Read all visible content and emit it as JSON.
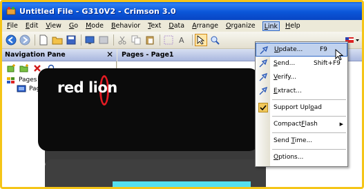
{
  "window": {
    "title": "Untitled File - G310V2 - Crimson 3.0"
  },
  "menubar": [
    {
      "pre": "",
      "u": "F",
      "post": "ile"
    },
    {
      "pre": "",
      "u": "E",
      "post": "dit"
    },
    {
      "pre": "",
      "u": "V",
      "post": "iew"
    },
    {
      "pre": "",
      "u": "G",
      "post": "o"
    },
    {
      "pre": "",
      "u": "M",
      "post": "ode"
    },
    {
      "pre": "",
      "u": "B",
      "post": "ehavior"
    },
    {
      "pre": "",
      "u": "T",
      "post": "ext"
    },
    {
      "pre": "",
      "u": "D",
      "post": "ata"
    },
    {
      "pre": "",
      "u": "A",
      "post": "rrange"
    },
    {
      "pre": "",
      "u": "O",
      "post": "rganize"
    },
    {
      "pre": "",
      "u": "L",
      "post": "ink"
    },
    {
      "pre": "",
      "u": "H",
      "post": "elp"
    }
  ],
  "nav": {
    "title": "Navigation Pane",
    "close": "✕",
    "tree": {
      "root": "Pages",
      "child": "Page1"
    }
  },
  "pages_header": "Pages - Page1",
  "logo": {
    "text": "red lion"
  },
  "link_menu": {
    "update": {
      "pre": "",
      "u": "U",
      "post": "pdate...",
      "shortcut": "F9"
    },
    "send": {
      "pre": "",
      "u": "S",
      "post": "end...",
      "shortcut": "Shift+F9"
    },
    "verify": {
      "pre": "",
      "u": "V",
      "post": "erify..."
    },
    "extract": {
      "pre": "",
      "u": "E",
      "post": "xtract..."
    },
    "support_upload": {
      "pre": "Support Upl",
      "u": "o",
      "post": "ad",
      "checked": true
    },
    "compactflash": {
      "pre": "Compact",
      "u": "F",
      "post": "lash"
    },
    "send_time": {
      "pre": "Send ",
      "u": "T",
      "post": "ime..."
    },
    "options": {
      "pre": "",
      "u": "O",
      "post": "ptions..."
    }
  },
  "colors": {
    "title_blue": "#0b56d8",
    "highlight": "#c1d2ee",
    "brand_red": "#e21b23",
    "cyan": "#56e0ef"
  }
}
